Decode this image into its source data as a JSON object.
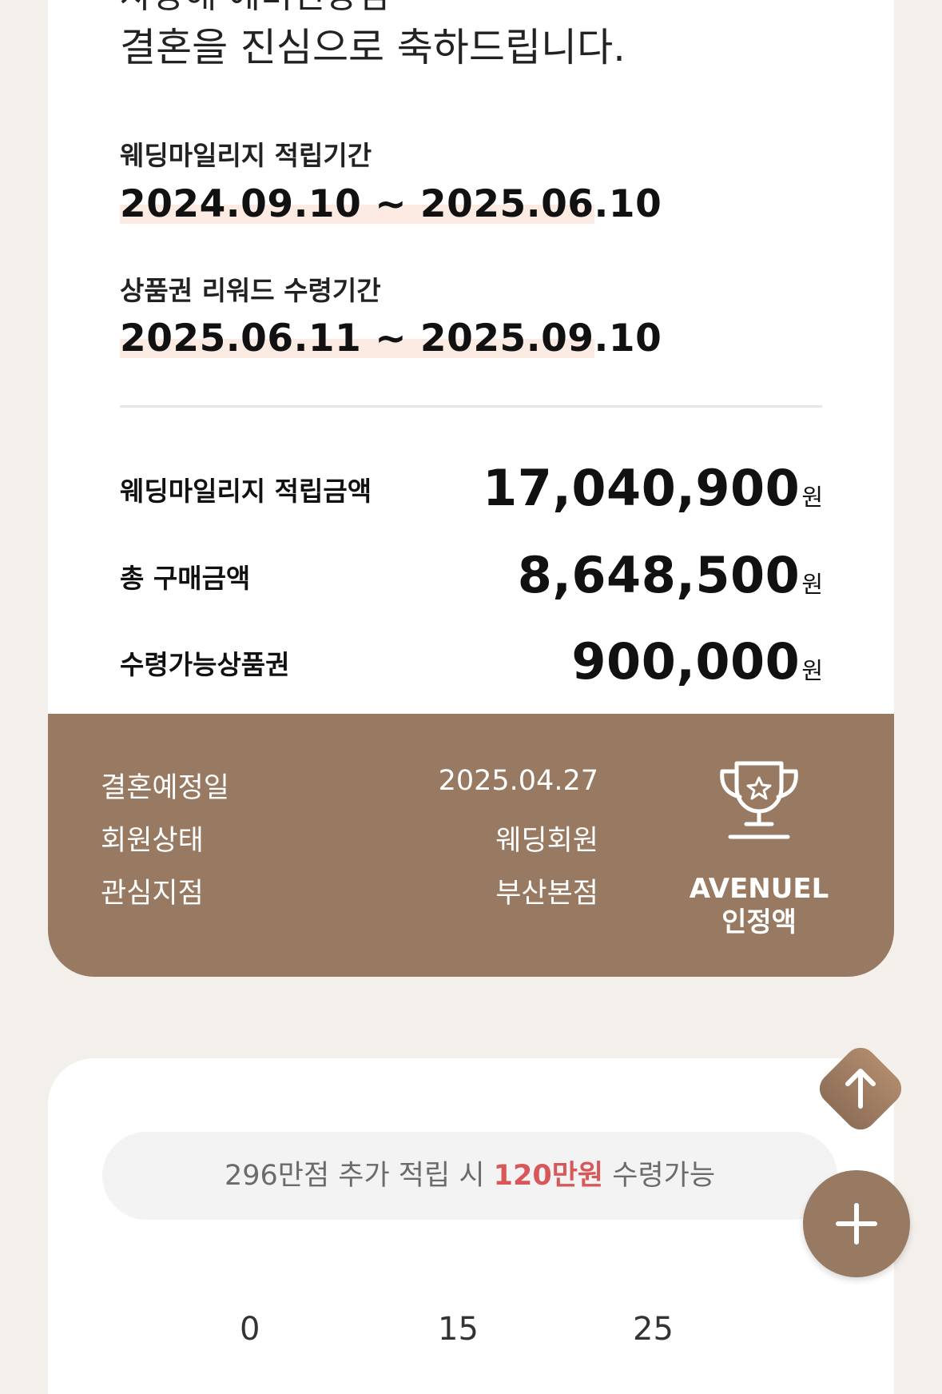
{
  "greeting": {
    "line_partial": "사랑해 예비신랑님",
    "line": "결혼을 진심으로 축하드립니다."
  },
  "periods": [
    {
      "label": "웨딩마일리지 적립기간",
      "value": "2024.09.10 ~ 2025.06.10"
    },
    {
      "label": "상품권 리워드 수령기간",
      "value": "2025.06.11 ~ 2025.09.10"
    }
  ],
  "stats": [
    {
      "label": "웨딩마일리지 적립금액",
      "value": "17,040,900",
      "unit": "원"
    },
    {
      "label": "총 구매금액",
      "value": "8,648,500",
      "unit": "원"
    },
    {
      "label": "수령가능상품권",
      "value": "900,000",
      "unit": "원"
    }
  ],
  "member_info": [
    {
      "label": "결혼예정일",
      "value": "2025.04.27"
    },
    {
      "label": "회원상태",
      "value": "웨딩회원"
    },
    {
      "label": "관심지점",
      "value": "부산본점"
    }
  ],
  "badge": {
    "line1": "AVENUEL",
    "line2": "인정액",
    "icon": "trophy-icon"
  },
  "notice": {
    "prefix": "296만점 추가 적립 시 ",
    "highlight": "120만원",
    "suffix": " 수령가능",
    "highlight_color": "#d8585a"
  },
  "peek_labels": [
    "0",
    "15",
    "25"
  ],
  "buttons": {
    "scroll_top_icon": "arrow-up-icon",
    "add_icon": "plus-icon"
  },
  "colors": {
    "brand_brown": "#987a63",
    "highlight_band": "#fcebe2",
    "background": "#f3efeb"
  }
}
